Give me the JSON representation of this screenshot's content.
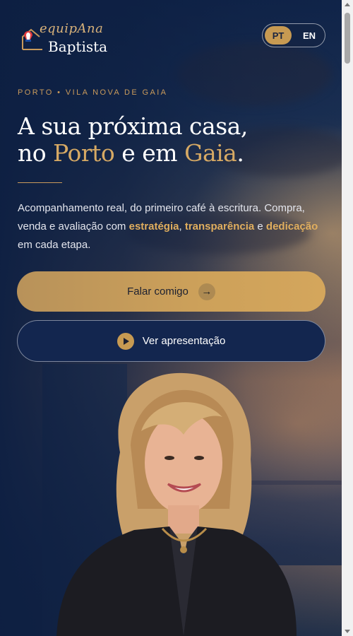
{
  "header": {
    "logo_line1": "equipAna",
    "logo_line2": "Baptista",
    "languages": [
      {
        "label": "PT",
        "active": true
      },
      {
        "label": "EN",
        "active": false
      }
    ]
  },
  "hero": {
    "eyebrow": "PORTO • VILA NOVA DE GAIA",
    "headline": {
      "line1": "A sua próxima casa,",
      "part_no": "no ",
      "porto": "Porto",
      "part_e": " e em ",
      "gaia": "Gaia",
      "dot": "."
    },
    "intro": {
      "part1": "Acompanhamento real, do primeiro café à escritura. Compra, venda e avaliação com ",
      "hl1": "estratégia",
      "sep1": ", ",
      "hl2": "transparência",
      "sep2": " e ",
      "hl3": "dedicação",
      "part2": " em cada etapa."
    },
    "primary_button": {
      "label": "Falar comigo",
      "icon": "arrow-right-icon"
    },
    "secondary_button": {
      "label": "Ver apresentação",
      "icon": "play-icon"
    }
  },
  "colors": {
    "navy": "#0f2145",
    "gold": "#c79a52",
    "accent_text": "#d6a964"
  }
}
